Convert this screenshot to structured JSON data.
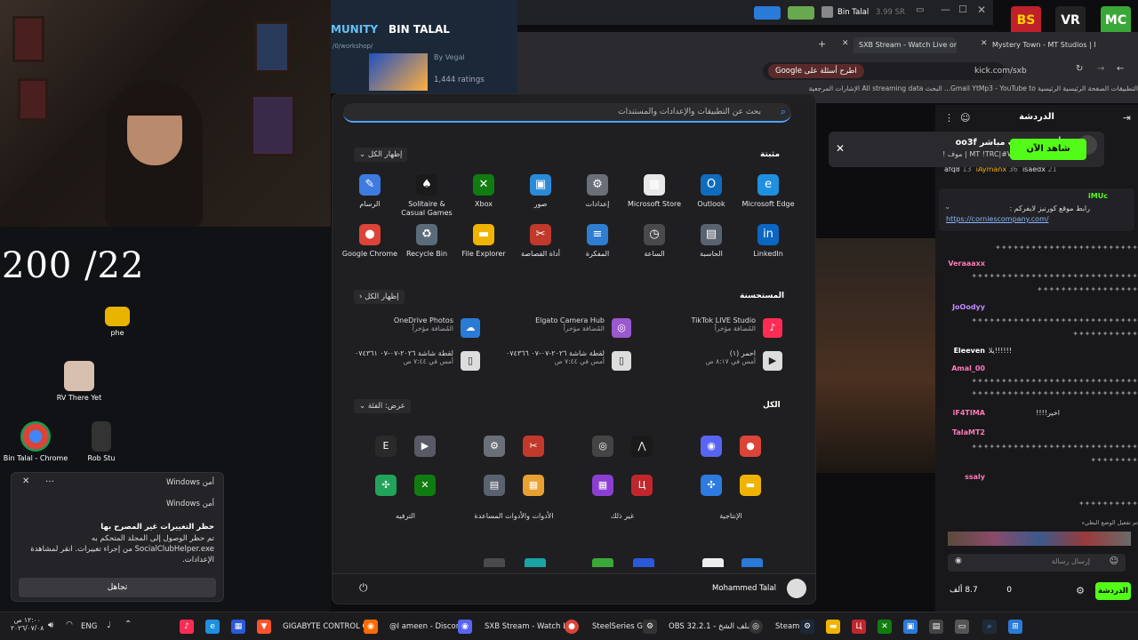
{
  "overlay": {
    "counter": "200 /22"
  },
  "desktop": {
    "icons": [
      {
        "label": "phe",
        "icon": "folder-icon"
      },
      {
        "label": "RV There Yet",
        "icon": "game-icon"
      },
      {
        "label": "Bin Talal - Chrome",
        "icon": "chrome-icon"
      },
      {
        "label": "Rob Stu",
        "icon": "roblox-icon"
      }
    ]
  },
  "toast": {
    "app": "أمن Windows",
    "source": "أمن Windows",
    "title": "حظر التغييرات غير المصرح بها",
    "body1": "تم حظر الوصول إلى المجلد المتحكم به",
    "body2": "SocialClubHelper.exe من إجراء تغييرات. انقر لمشاهدة",
    "body3": "الإعدادات.",
    "dismiss": "تجاهل",
    "close_glyph": "✕",
    "more_glyph": "…"
  },
  "steam": {
    "nav_community": "MUNITY",
    "nav_user": "BIN TALAL",
    "path": "/0/workshop/",
    "item_author": "By Vegal",
    "ratings": "1,444 ratings"
  },
  "titlebar": {
    "user": "Bin Talal",
    "balance": "3.99 SR"
  },
  "browser": {
    "tabs": [
      "SXB Stream - Watch Live on",
      "Mystery Town - MT Studios | M"
    ],
    "address": "kick.com/sxb",
    "ask_google": "اطرح أسئلة على Google",
    "bookmarks": "التطبيقات  الصفحة الرئيسية  الرئيسية  Gmail  YtMp3 - YouTube to...  البحث  All streaming data  الإشارات المرجعية"
  },
  "chat": {
    "header": "الدردشة",
    "top_users": [
      {
        "name": "iAymanx",
        "n": "36"
      },
      {
        "name": "isaedx",
        "n": "21"
      },
      {
        "name": "afq8",
        "n": "13"
      }
    ],
    "pinned_user": "iMUc",
    "pinned_text": "رابط موقع كورنيز لايفركم :",
    "pinned_link": "https://corniescompany.com/",
    "messages": [
      {
        "user": "Veraaaxx",
        "text": "",
        "color": "#ff7ab8"
      },
      {
        "user": "JoOodyy",
        "text": "",
        "color": "#c58bff"
      },
      {
        "user": "Eleeven",
        "text": "!!!!!!يلا",
        "color": "#ffffff"
      },
      {
        "user": "Amal_00",
        "text": "",
        "color": "#ff7ab8"
      },
      {
        "user": "iF4TIMA",
        "text": "اخير!!!!",
        "color": "#ff7ab8"
      },
      {
        "user": "TalaMT2",
        "text": "",
        "color": "#ff7ab8"
      },
      {
        "user": "ssaly",
        "text": "",
        "color": "#ff7ab8"
      }
    ],
    "slow_mode": "تم تفعيل الوضع البطيء",
    "send_placeholder": "إرسال رسالة",
    "viewers": "8.7 ألف",
    "zero": "0",
    "send_button": "الدردشة"
  },
  "notif": {
    "title": "ابدأ للتو في بث مباشر oo3f",
    "subtitle": "MT !TRC|#WeAreMysterTown | موف !",
    "watch": "شاهد الآن"
  },
  "overlay_apps": [
    "BS",
    "VR",
    "MC"
  ],
  "start": {
    "search_placeholder": "بحث عن التطبيقات والإعدادات والمستندات",
    "pinned_title": "مثبتة",
    "show_all": "إظهار الكل",
    "pinned": [
      {
        "label": "Microsoft Edge",
        "glyph": "e",
        "color": "#1f8fe0"
      },
      {
        "label": "Outlook",
        "glyph": "O",
        "color": "#0f6cbd"
      },
      {
        "label": "Microsoft Store",
        "glyph": "▦",
        "color": "#e8e8e8"
      },
      {
        "label": "إعدادات",
        "glyph": "⚙",
        "color": "#6b6f78"
      },
      {
        "label": "صور",
        "glyph": "▣",
        "color": "#2b8ad8"
      },
      {
        "label": "Xbox",
        "glyph": "✕",
        "color": "#107c10"
      },
      {
        "label": "Solitaire & Casual Games",
        "glyph": "♠",
        "color": "#1a1a1a"
      },
      {
        "label": "الرسام",
        "glyph": "✎",
        "color": "#3d7be0"
      },
      {
        "label": "LinkedIn",
        "glyph": "in",
        "color": "#0a66c2"
      },
      {
        "label": "الحاسبة",
        "glyph": "▤",
        "color": "#5a6270"
      },
      {
        "label": "الساعة",
        "glyph": "◷",
        "color": "#4a4a4e"
      },
      {
        "label": "المفكرة",
        "glyph": "≡",
        "color": "#2f7dd1"
      },
      {
        "label": "أداة القصاصة",
        "glyph": "✂",
        "color": "#c0392b"
      },
      {
        "label": "File Explorer",
        "glyph": "▬",
        "color": "#f0b400"
      },
      {
        "label": "Recycle Bin",
        "glyph": "♻",
        "color": "#5b6b7a"
      },
      {
        "label": "Google Chrome",
        "glyph": "●",
        "color": "#db4437"
      }
    ],
    "recommended_title": "المستحسنة",
    "recommended": [
      {
        "name": "TikTok LIVE Studio",
        "sub": "المُضافة مؤخراً",
        "glyph": "♪",
        "color": "#fe2c55"
      },
      {
        "name": "Elgato Camera Hub",
        "sub": "المُضافة مؤخراً",
        "glyph": "◎",
        "color": "#9b59d0"
      },
      {
        "name": "OneDrive Photos",
        "sub": "المُضافة مؤخراً",
        "glyph": "☁",
        "color": "#2a7ad8"
      },
      {
        "name": "احمر (١)",
        "sub": "أمس في ٨:١٧ ص",
        "glyph": "▶",
        "color": "#ddd"
      },
      {
        "name": "لقطة شاشة ٢٠٢٦-٠٧-٠٧ ٠٧٤٣٦٦",
        "sub": "أمس في ٧:٤٤ ص",
        "glyph": "▯",
        "color": "#ddd"
      },
      {
        "name": "لقطة شاشة ٢٠٢٦-٠٧-٠٧ ٠٧٤٣٦١",
        "sub": "أمس في ٧:٤٤ ص",
        "glyph": "▯",
        "color": "#ddd"
      }
    ],
    "all_title": "الكل",
    "view_label": "عرض: الفئة",
    "categories": [
      {
        "label": "الإنتاجية",
        "icons": [
          {
            "g": "◉",
            "c": "#5865f2"
          },
          {
            "g": "●",
            "c": "#db4437"
          },
          {
            "g": "✣",
            "c": "#2d7be0"
          },
          {
            "g": "▬",
            "c": "#f0b400"
          }
        ]
      },
      {
        "label": "غير ذلك",
        "icons": [
          {
            "g": "◎",
            "c": "#444"
          },
          {
            "g": "⋀",
            "c": "#1a1a1a"
          },
          {
            "g": "▦",
            "c": "#8a3fd1"
          },
          {
            "g": "Ц",
            "c": "#c0272d"
          }
        ]
      },
      {
        "label": "الأدوات والأدوات المساعدة",
        "icons": [
          {
            "g": "⚙",
            "c": "#6b6f78"
          },
          {
            "g": "✂",
            "c": "#c0392b"
          },
          {
            "g": "▤",
            "c": "#5a6270"
          },
          {
            "g": "▦",
            "c": "#e8a030"
          }
        ]
      },
      {
        "label": "الترفيه",
        "icons": [
          {
            "g": "E",
            "c": "#2a2a2a"
          },
          {
            "g": "▶",
            "c": "#5a5a66"
          },
          {
            "g": "✣",
            "c": "#22a35a"
          },
          {
            "g": "✕",
            "c": "#107c10"
          }
        ]
      }
    ],
    "user_name": "Mohammed Talal",
    "power_glyph": "⏻"
  },
  "taskbar": {
    "clock_time": "١٢:٠٠ ص",
    "clock_date": "٢٠٢٦/٠٧/٠٨",
    "lang": "ENG",
    "apps": [
      {
        "label": "GIGABYTE CONTROL CE"
      },
      {
        "label": "@I ameen - Discord"
      },
      {
        "label": "SXB Stream - Watch Live"
      },
      {
        "label": "SteelSeries GG"
      },
      {
        "label": "OBS 32.2.1 - الملف الشخ"
      },
      {
        "label": "Steam"
      }
    ]
  }
}
